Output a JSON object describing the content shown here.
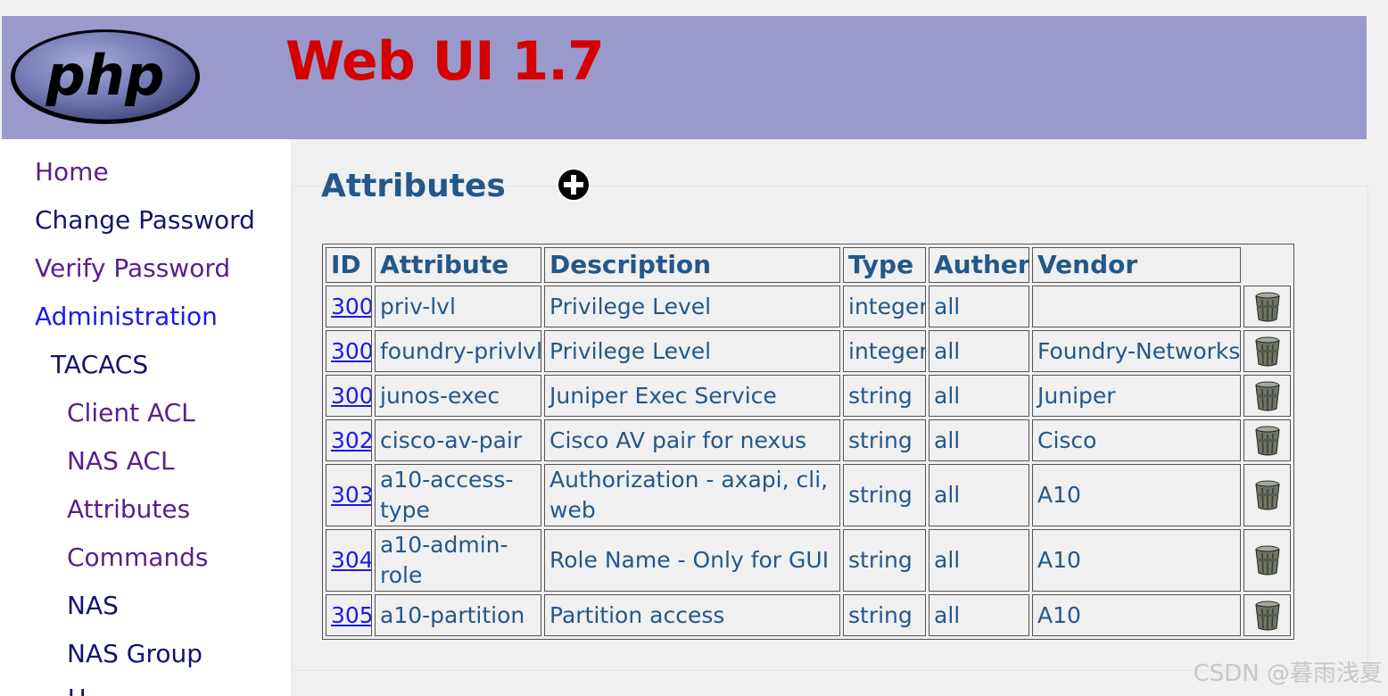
{
  "app": {
    "logo_text": "php",
    "title": "Web UI 1.7"
  },
  "nav": {
    "home": "Home",
    "change_password": "Change Password",
    "verify_password": "Verify Password",
    "administration": "Administration",
    "tacacs": "TACACS",
    "client_acl": "Client ACL",
    "nas_acl": "NAS ACL",
    "attributes": "Attributes",
    "commands": "Commands",
    "nas": "NAS",
    "nas_group": "NAS Group",
    "next_partial": "U"
  },
  "section": {
    "title": "Attributes",
    "add_icon": "plus-circle-icon"
  },
  "table": {
    "headers": {
      "id": "ID",
      "attribute": "Attribute",
      "description": "Description",
      "type": "Type",
      "authen": "Authen",
      "vendor": "Vendor"
    },
    "rows": [
      {
        "id": "300",
        "attribute": "priv-lvl",
        "description": "Privilege Level",
        "type": "integer",
        "authen": "all",
        "vendor": ""
      },
      {
        "id": "300",
        "attribute": "foundry-privlvl",
        "description": "Privilege Level",
        "type": "integer",
        "authen": "all",
        "vendor": "Foundry-Networks"
      },
      {
        "id": "300",
        "attribute": "junos-exec",
        "description": "Juniper Exec Service",
        "type": "string",
        "authen": "all",
        "vendor": "Juniper"
      },
      {
        "id": "302",
        "attribute": "cisco-av-pair",
        "description": "Cisco AV pair for nexus",
        "type": "string",
        "authen": "all",
        "vendor": "Cisco"
      },
      {
        "id": "303",
        "attribute": "a10-access-type",
        "description": "Authorization - axapi, cli, web",
        "type": "string",
        "authen": "all",
        "vendor": "A10"
      },
      {
        "id": "304",
        "attribute": "a10-admin-role",
        "description": "Role Name - Only for GUI",
        "type": "string",
        "authen": "all",
        "vendor": "A10"
      },
      {
        "id": "305",
        "attribute": "a10-partition",
        "description": "Partition access",
        "type": "string",
        "authen": "all",
        "vendor": "A10"
      }
    ],
    "delete_icon": "trash-can-icon"
  },
  "watermark": "CSDN @暮雨浅夏",
  "colors": {
    "header_bg": "#9999cc",
    "title_red": "#d40000",
    "table_text": "#24578a",
    "link_blue": "#1a1aee"
  }
}
